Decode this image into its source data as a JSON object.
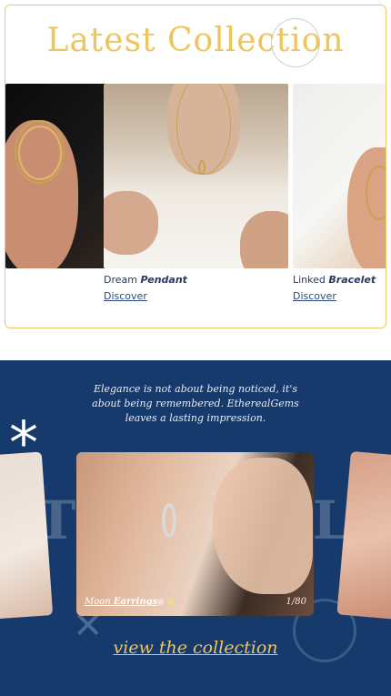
{
  "collection": {
    "title": "Latest Collection",
    "items": [
      {
        "name_prefix": "",
        "name_emphasis": "",
        "link": ""
      },
      {
        "name_prefix": "Dream",
        "name_emphasis": "Pendant",
        "link": "Discover"
      },
      {
        "name_prefix": "Linked",
        "name_emphasis": "Bracelet",
        "link": "Discover"
      }
    ]
  },
  "featured": {
    "quote": "Elegance is not about being noticed, it's about being remembered. EtherealGems leaves a lasting impression.",
    "background_word": "ETHEREALGEMS",
    "main_card": {
      "name_prefix": "Moon",
      "name_emphasis": "Earrings",
      "counter": "1/80",
      "dot_colors": [
        "#f4dede",
        "#f2d98a",
        "#f2c7c0"
      ]
    },
    "view_link": "view the collection"
  },
  "colors": {
    "accent": "#eec45c",
    "navy": "#163a6b",
    "border": "#e9c96a"
  }
}
